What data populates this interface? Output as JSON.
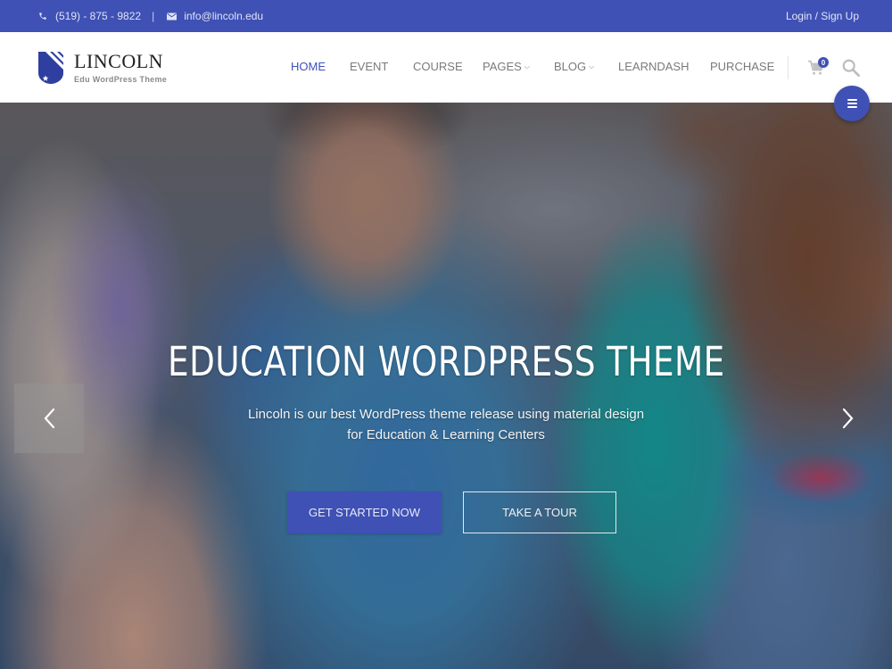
{
  "topbar": {
    "phone_icon": "phone-icon",
    "phone": "(519) - 875 - 9822",
    "separator": "|",
    "email_icon": "mail-icon",
    "email": "info@lincoln.edu",
    "login": "Login / Sign Up"
  },
  "header": {
    "logo": {
      "icon": "shield-icon",
      "name": "LINCOLN",
      "tagline": "Edu WordPress Theme"
    },
    "nav": [
      {
        "label": "HOME",
        "active": true,
        "dropdown": false
      },
      {
        "label": "EVENT",
        "active": false,
        "dropdown": false
      },
      {
        "label": "COURSE",
        "active": false,
        "dropdown": false
      },
      {
        "label": "PAGES",
        "active": false,
        "dropdown": true
      },
      {
        "label": "BLOG",
        "active": false,
        "dropdown": true
      },
      {
        "label": "LEARNDASH",
        "active": false,
        "dropdown": false
      },
      {
        "label": "PURCHASE",
        "active": false,
        "dropdown": false
      }
    ],
    "dropdown_glyph": "⌄",
    "cart": {
      "icon": "cart-icon",
      "count": "0"
    },
    "search_icon": "search-icon",
    "menu_fab_icon": "hamburger-icon"
  },
  "hero": {
    "title": "EDUCATION WORDPRESS THEME",
    "subtitle_line1": "Lincoln is our best WordPress theme release using material design",
    "subtitle_line2": "for Education & Learning Centers",
    "primary_button": "GET STARTED NOW",
    "secondary_button": "TAKE A TOUR",
    "prev_icon": "chevron-left-icon",
    "next_icon": "chevron-right-icon"
  },
  "colors": {
    "brand": "#3f51b5",
    "nav_text": "#7a7a7a",
    "white": "#ffffff"
  }
}
